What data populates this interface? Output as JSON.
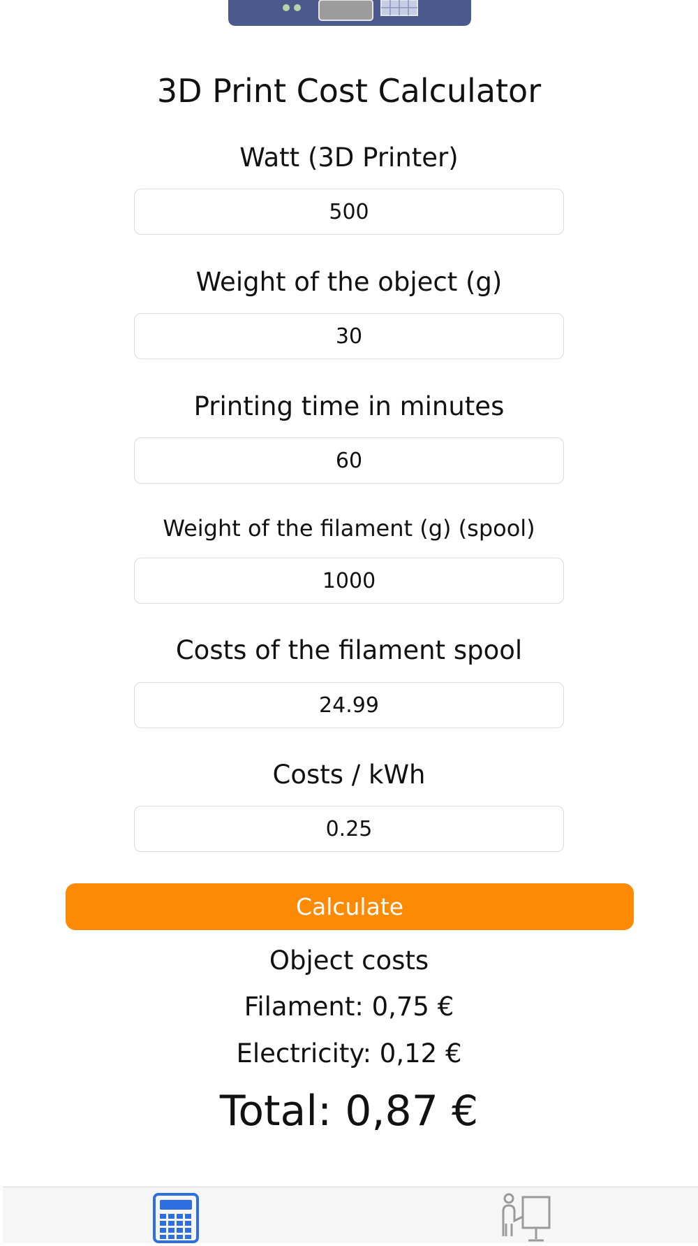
{
  "app": {
    "title": "3D Print Cost Calculator"
  },
  "form": {
    "watt": {
      "label": "Watt (3D Printer)",
      "value": "500"
    },
    "object_weight": {
      "label": "Weight of the object (g)",
      "value": "30"
    },
    "print_time": {
      "label": "Printing time in minutes",
      "value": "60"
    },
    "filament_weight": {
      "label": "Weight of the filament (g) (spool)",
      "value": "1000"
    },
    "spool_cost": {
      "label": "Costs of the filament spool",
      "value": "24.99"
    },
    "kwh_cost": {
      "label": "Costs / kWh",
      "value": "0.25"
    }
  },
  "actions": {
    "calculate_label": "Calculate"
  },
  "results": {
    "heading": "Object costs",
    "filament": "Filament: 0,75 €",
    "electricity": "Electricity: 0,12 €",
    "total": "Total: 0,87 €"
  },
  "tabs": [
    {
      "icon": "calculator-icon",
      "selected": true
    },
    {
      "icon": "presenter-icon",
      "selected": false
    }
  ],
  "colors": {
    "accent": "#fd8a05",
    "tab_active": "#2d6fe0",
    "tab_inactive": "#9a9a9a",
    "printer_body": "#4a5a8c"
  }
}
